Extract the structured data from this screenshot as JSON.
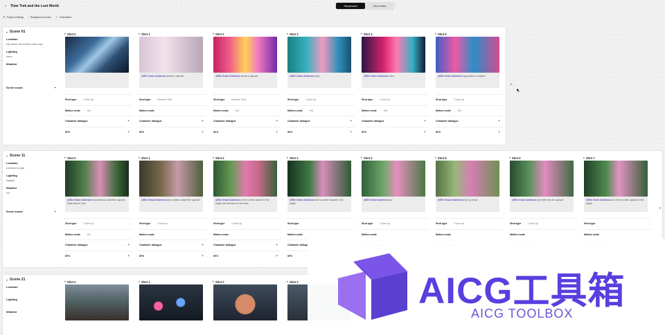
{
  "header": {
    "title": "Time Trek and the Lost World",
    "back_icon": "chevron-left-icon",
    "nav": [
      "Project settings",
      "Background music",
      "Characters"
    ],
    "tabs": [
      {
        "label": "Storyboard",
        "active": true
      },
      {
        "label": "Shot editor",
        "active": false
      }
    ]
  },
  "scenes": [
    {
      "name": "Scene 01",
      "location": "big human size broken white caps",
      "lighting": "warm",
      "weather": "",
      "sound": "Scene sound",
      "shots": [
        {
          "name": "Shot 0",
          "caption": "",
          "type": "Close Up",
          "motion": "HQ",
          "img": "linear-gradient(135deg,#1a2a44 0%,#3e6d9c 35%,#9fc7e5 50%,#2d4f75 70%,#0c1424 100%)"
        },
        {
          "name": "Shot 1",
          "caption_tag": "@Elle Grace Anderson",
          "caption": " stands a capsule",
          "type": "Medium Shot",
          "motion": "",
          "img": "linear-gradient(90deg,#d7c7d4 0%,#f1e1ea 40%,#d6c3d1 70%,#b7a6b5 100%)"
        },
        {
          "name": "Shot 2",
          "caption_tag": "@Elle Grace Anderson",
          "caption": " stands a capsule",
          "type": "Medium Shot",
          "motion": "HQ",
          "img": "linear-gradient(90deg,#c3255f 0%,#ee5a8c 25%,#ffd257 50%,#f07ac1 70%,#6f2aa8 100%)"
        },
        {
          "name": "Shot 3",
          "caption_tag": "@Elle Grace Anderson",
          "caption": " eyes",
          "type": "Close Up",
          "motion": "HQ",
          "img": "linear-gradient(90deg,#1a7f7f 0%,#36b1c0 30%,#f09ac0 55%,#2f8fb8 80%,#1a4f6f 100%)"
        },
        {
          "name": "Shot 4",
          "caption_tag": "@Elle Grace Anderson",
          "caption": " hand",
          "type": "Close Up",
          "motion": "HQ",
          "img": "linear-gradient(90deg,#2a1644 0%,#d8246f 35%,#ff7bb1 55%,#36b0c4 80%,#121a38 100%)"
        },
        {
          "name": "Shot 5",
          "caption_tag": "@Elle Grace Anderson",
          "caption": " approaches a capsule",
          "type": "Close Up",
          "motion": "HQ",
          "img": "linear-gradient(90deg,#3a5fc4 0%,#ed5aa6 30%,#2a8ec7 60%,#d44b8f 100%)"
        }
      ]
    },
    {
      "name": "Scene 11",
      "location": "prehistoric jungle",
      "lighting": "daylight",
      "weather": "hot",
      "sound": "Scene sound",
      "shots": [
        {
          "name": "Shot 0",
          "caption_tag": "@Elle Grace Anderson",
          "caption": " eyes treats a small time capsule floats back in time",
          "type": "Close Up",
          "motion": "HQ",
          "img": "linear-gradient(90deg,#1f3b26 0%,#4f7f49 30%,#d88fb5 55%,#3d6a3a 80%,#1a2c1c 100%)"
        },
        {
          "name": "Shot 1",
          "caption_tag": "@Elle Grace Anderson",
          "caption": " eyes create a small time capsule",
          "type": "Close Up",
          "motion": "",
          "img": "linear-gradient(90deg,#3a3a2a 0%,#7a6a4e 35%,#c69aa8 60%,#4d5f3c 100%)"
        },
        {
          "name": "Shot 2",
          "caption_tag": "@Elle Grace Anderson",
          "caption": " next to a time capsule in the jungle with dinosaurs in the back",
          "type": "Close Up",
          "motion": "",
          "img": "linear-gradient(90deg,#2c5a32 0%,#6c9b58 30%,#e07ab0 50%,#c96a8a 70%,#35623a 100%)"
        },
        {
          "name": "Shot 3",
          "caption_tag": "@Elle Grace Anderson",
          "caption": " next to a time capsule in the jungle",
          "type": "",
          "motion": "",
          "img": "linear-gradient(90deg,#16311f 0%,#3f7a45 35%,#d98dbd 55%,#2d5c35 100%)"
        },
        {
          "name": "Shot 4",
          "caption_tag": "@Elle Grace Anderson",
          "caption": " eye",
          "type": "Close Up",
          "motion": "",
          "img": "linear-gradient(90deg,#2f5f3a 0%,#6fa96a 35%,#e690c0 55%,#497a44 100%)"
        },
        {
          "name": "Shot 5",
          "caption_tag": "@Elle Grace Anderson",
          "caption": "close up of  eye",
          "type": "Close Up",
          "motion": "",
          "img": "linear-gradient(90deg,#587044 0%,#96b87a 30%,#d77fb4 55%,#6f8f52 100%)"
        },
        {
          "name": "Shot 6",
          "caption_tag": "@Elle Grace Anderson",
          "caption": " eye while she are capsule",
          "type": "Close Up",
          "motion": "",
          "img": "linear-gradient(90deg,#274a2f 0%,#58905a 30%,#e38cbf 55%,#3f6b43 100%)"
        },
        {
          "name": "Shot 7",
          "caption_tag": "@Elle Grace Anderson",
          "caption": " run next to a time capsule in the jungle",
          "type": "",
          "motion": "",
          "img": "linear-gradient(90deg,#1f3f26 0%,#4f8a50 35%,#e293c2 55%,#345f37 100%)"
        }
      ]
    },
    {
      "name": "Scene 21",
      "location": "",
      "lighting": "",
      "weather": "",
      "sound": "",
      "shots": [
        {
          "name": "Shot 0",
          "img": "linear-gradient(180deg,#7f8d9c 0%,#4e5f5f 50%,#3a2f2a 100%)"
        },
        {
          "name": "Shot 1",
          "img": "radial-gradient(circle at 30% 60%,#ff5f9d 0 6px,transparent 7px),radial-gradient(circle at 65% 50%,#6aa2ff 0 6px,transparent 7px),linear-gradient(180deg,#2a3440 0%,#141a22 100%)"
        },
        {
          "name": "Shot 2",
          "img": "radial-gradient(circle at 50% 55%,#d68a6a 0 14px,transparent 15px),linear-gradient(180deg,#3e4b5a 0%,#1f2430 100%)"
        },
        {
          "name": "Shot 3",
          "img": "linear-gradient(180deg,#4a5a6a 0%,#2a3038 100%)"
        }
      ]
    }
  ],
  "labels": {
    "location": "Location",
    "lighting": "Lighting",
    "weather": "Weather",
    "shot_type": "Shot type",
    "motion_scale": "Motion scale",
    "char_dialogue": "Character dialogue",
    "sfx": "SFX"
  },
  "watermark": {
    "title": "AICG工具箱",
    "subtitle": "AICG TOOLBOX"
  }
}
